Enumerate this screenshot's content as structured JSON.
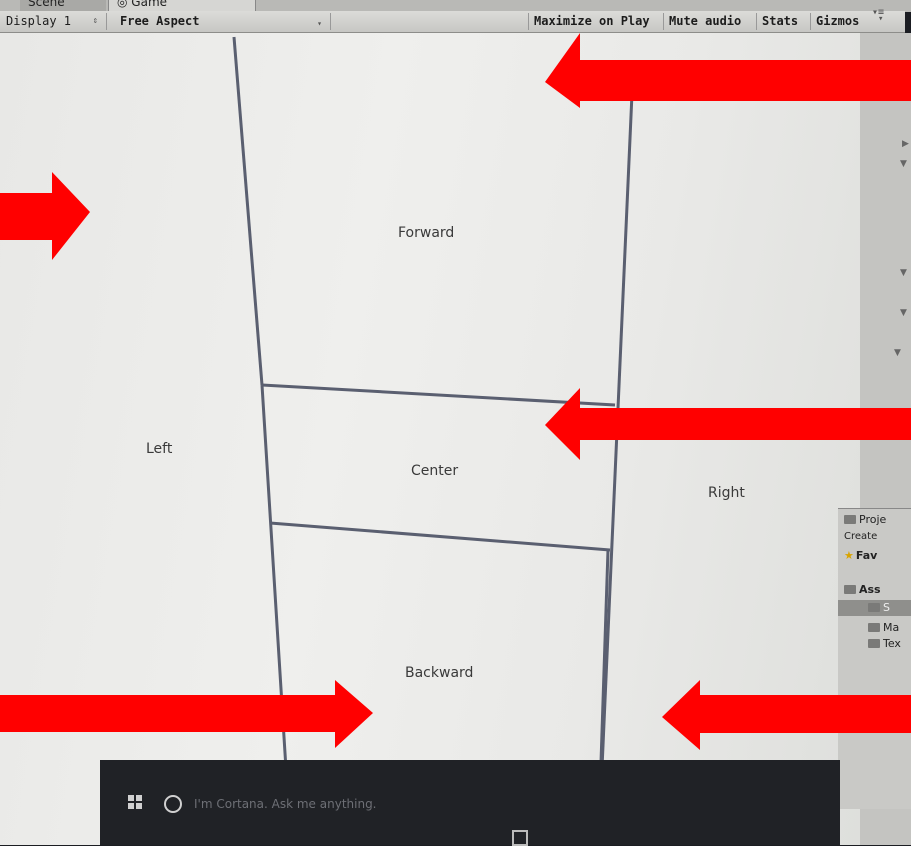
{
  "tabs": {
    "scene": "Scene",
    "game": "Game"
  },
  "toolbar": {
    "display": "Display 1",
    "aspect": "Free Aspect",
    "maximize": "Maximize on Play",
    "mute": "Mute audio",
    "stats": "Stats",
    "gizmos": "Gizmos"
  },
  "zones": {
    "forward": "Forward",
    "left": "Left",
    "center": "Center",
    "right": "Right",
    "backward": "Backward"
  },
  "project": {
    "header": "Proje",
    "create": "Create",
    "favorites": "Fav",
    "assets": "Ass",
    "selected": "S",
    "materials": "Ma",
    "textures": "Tex"
  },
  "taskbar": {
    "cortana_placeholder": "I'm Cortana. Ask me anything."
  },
  "colors": {
    "arrow": "#ff0000",
    "divider": "#5a5f70"
  }
}
